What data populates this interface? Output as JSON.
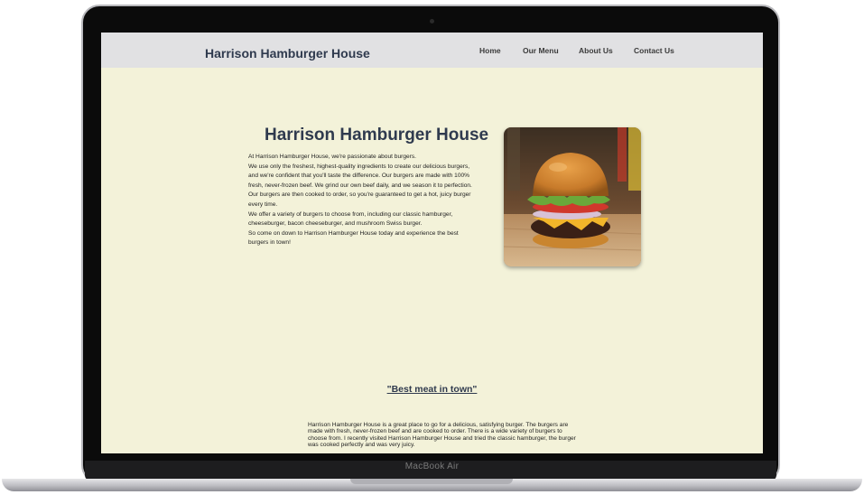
{
  "device": {
    "label": "MacBook Air"
  },
  "header": {
    "brand": "Harrison Hamburger House",
    "nav": [
      "Home",
      "Our Menu",
      "About Us",
      "Contact Us"
    ]
  },
  "hero": {
    "title": "Harrison Hamburger House",
    "paragraphs": [
      "At Harrison Hamburger House, we're passionate about burgers.",
      "We use only the freshest, highest-quality ingredients to create our delicious burgers, and we're confident that you'll taste the difference. Our burgers are made with 100% fresh, never-frozen beef. We grind our own beef daily, and we season it to perfection.",
      "Our burgers are then cooked to order, so you're guaranteed to get a hot, juicy burger every time.",
      "We offer a variety of burgers to choose from, including our classic hamburger, cheeseburger, bacon cheeseburger, and mushroom Swiss burger.",
      "So come on down to Harrison Hamburger House today and experience the best burgers in town!"
    ],
    "image_alt": "hamburger photo"
  },
  "testimonial": {
    "quote": "\"Best meat in town\"",
    "body": "Harrison Hamburger House is a great place to go for a delicious, satisfying burger. The burgers are made with fresh, never-frozen beef and are cooked to order. There is a wide variety of burgers to choose from. I recently visited Harrison Hamburger House and tried the classic hamburger, the burger was cooked perfectly and was very juicy."
  }
}
